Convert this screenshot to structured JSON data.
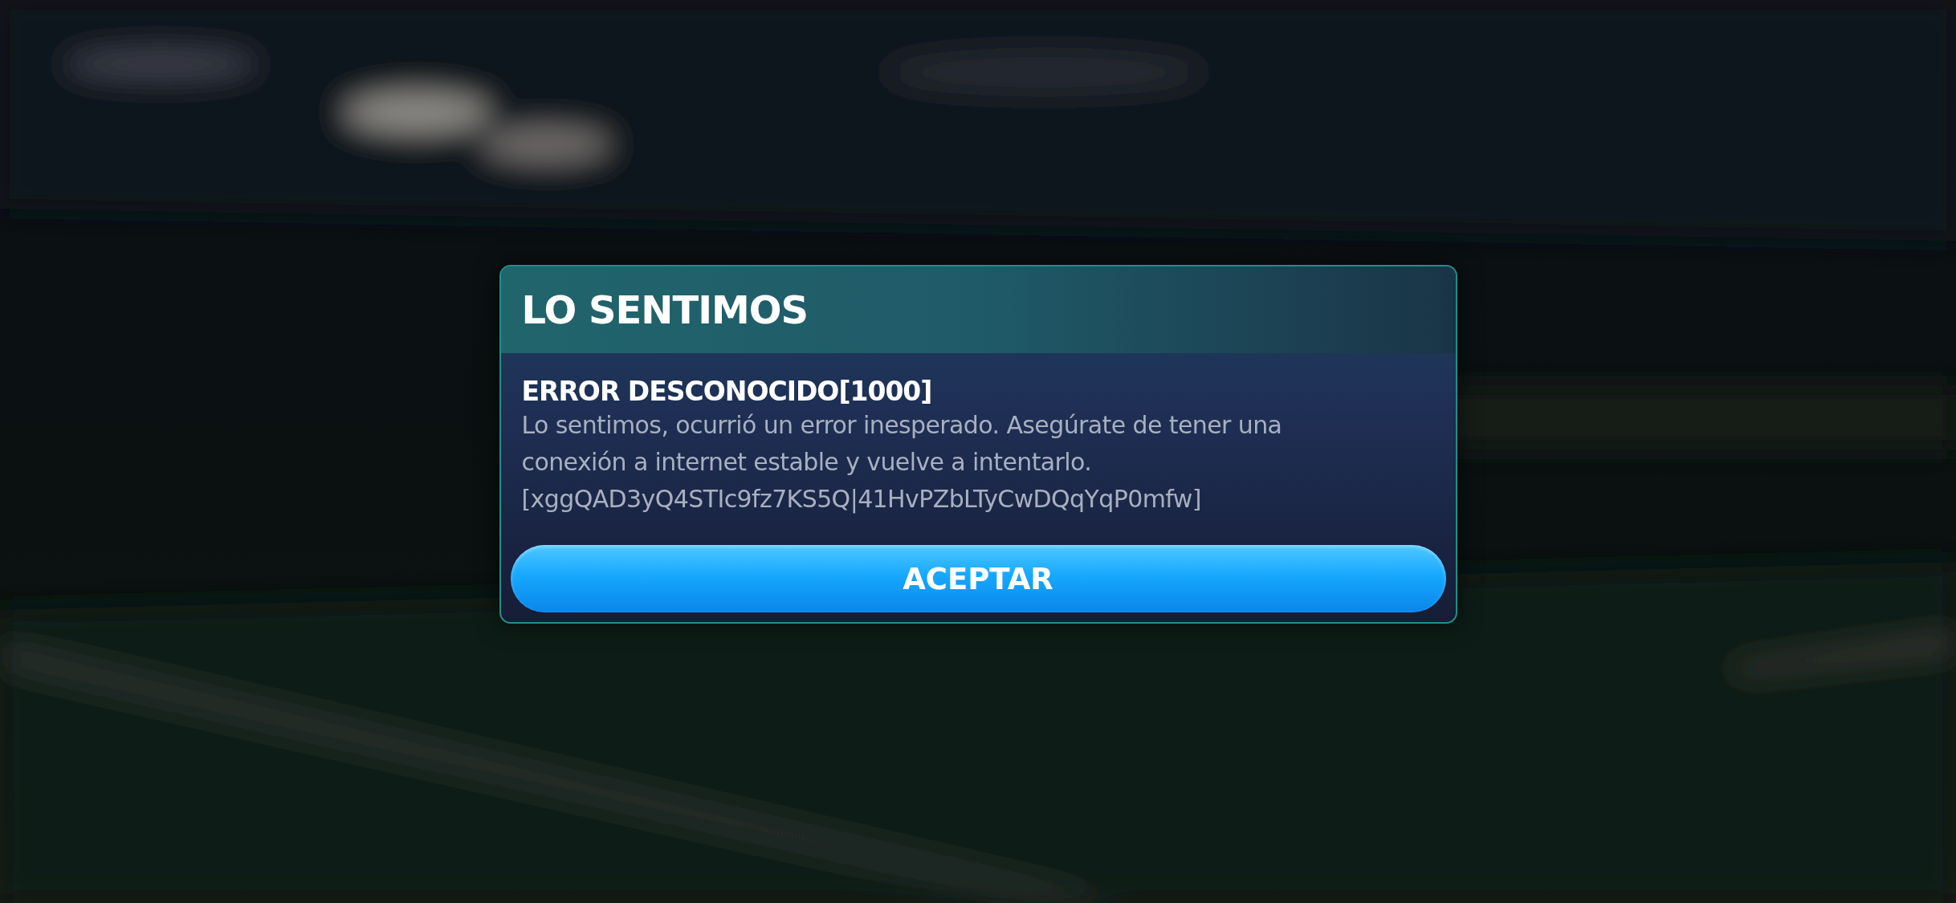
{
  "dialog": {
    "title": "LO SENTIMOS",
    "error_title": "ERROR DESCONOCIDO[1000]",
    "message": "Lo sentimos, ocurrió un error inesperado. Asegúrate de tener una conexión a internet estable y vuelve a intentarlo.",
    "code": "[xggQAD3yQ4STIc9fz7KS5Q|41HvPZbLTyCwDQqYqP0mfw]",
    "button": "ACEPTAR"
  }
}
